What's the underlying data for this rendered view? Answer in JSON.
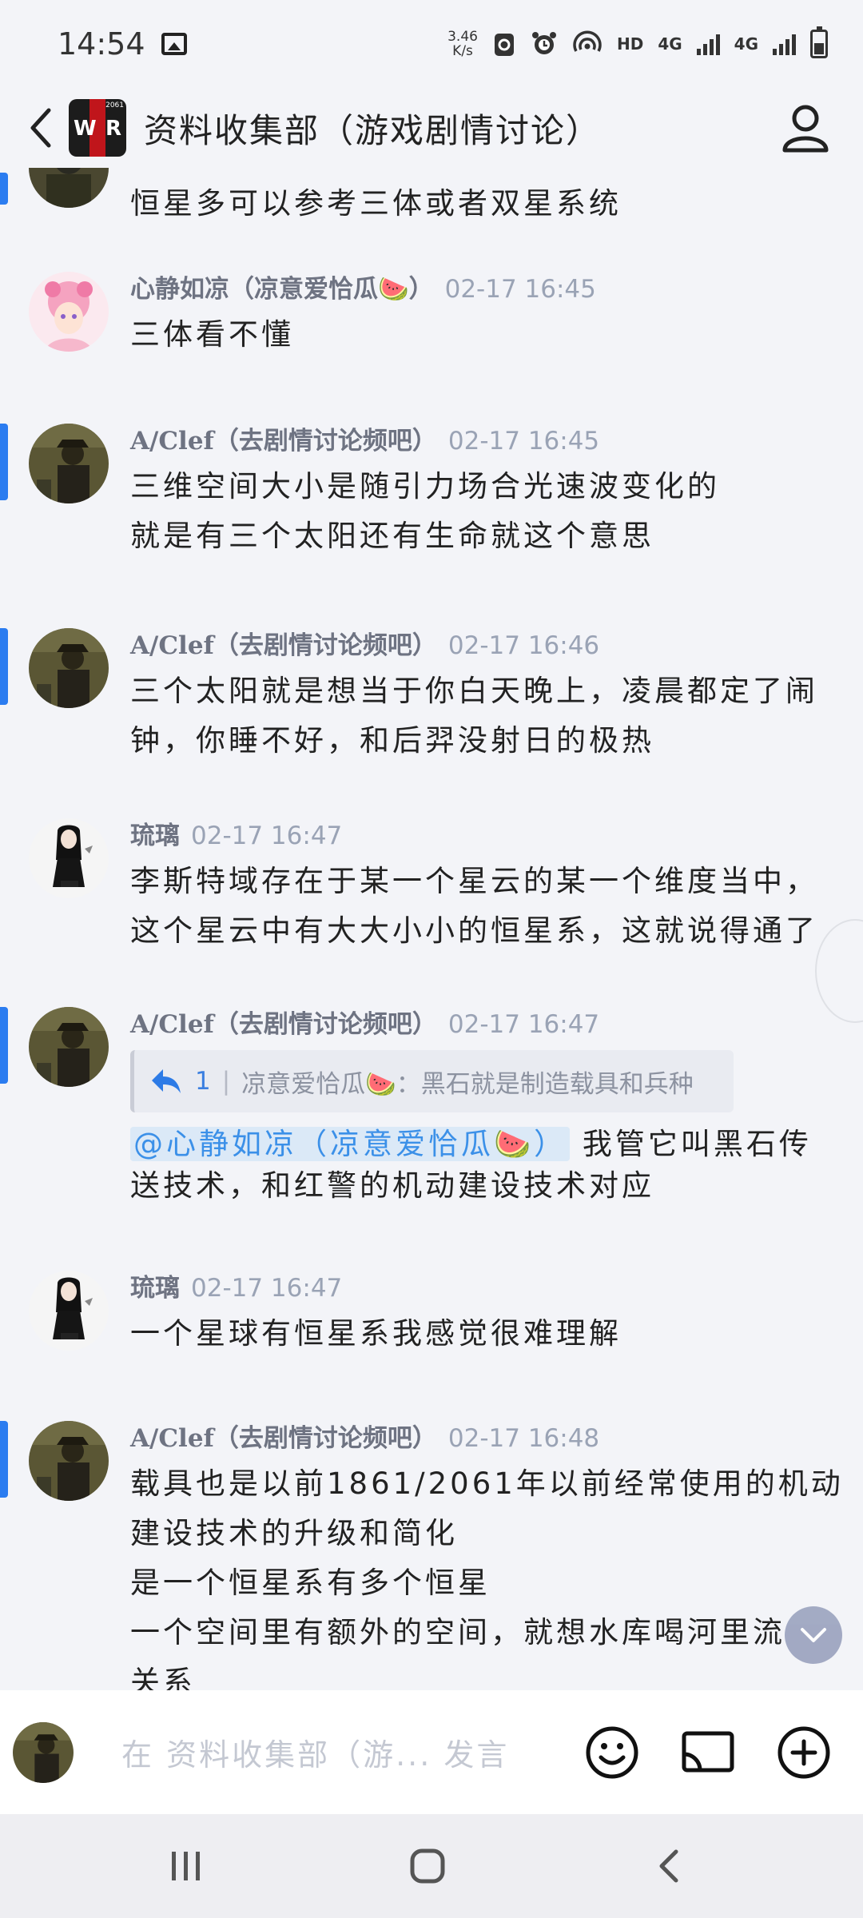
{
  "status_bar": {
    "time": "14:54",
    "net_speed_value": "3.46",
    "net_speed_unit": "K/s",
    "hd": "HD",
    "net1": "4G",
    "net2": "4G"
  },
  "header": {
    "title": "资料收集部（游戏剧情讨论）",
    "logo_year": "2061"
  },
  "messages": [
    {
      "id": "m0",
      "name": "",
      "time": "",
      "lines": [
        "恒星多可以参考三体或者双星系统"
      ]
    },
    {
      "id": "m1",
      "name": "心静如凉（凉意爱恰瓜🍉）",
      "time": "02-17 16:45",
      "lines": [
        "三体看不懂"
      ]
    },
    {
      "id": "m2",
      "name": "A/Clef（去剧情讨论频吧）",
      "time": "02-17 16:45",
      "lines": [
        "三维空间大小是随引力场合光速波变化的",
        "就是有三个太阳还有生命就这个意思"
      ]
    },
    {
      "id": "m3",
      "name": "A/Clef（去剧情讨论频吧）",
      "time": "02-17 16:46",
      "lines": [
        "三个太阳就是想当于你白天晚上，凌晨都定了闹",
        "钟，你睡不好，和后羿没射日的极热"
      ]
    },
    {
      "id": "m4",
      "name": "琉璃",
      "time": "02-17 16:47",
      "lines": [
        "李斯特域存在于某一个星云的某一个维度当中，",
        "这个星云中有大大小小的恒星系，这就说得通了"
      ]
    },
    {
      "id": "m5",
      "name": "A/Clef（去剧情讨论频吧）",
      "time": "02-17 16:47",
      "quote_count": "1",
      "quote_sep": "|",
      "quote_text": "凉意爱恰瓜🍉：黑石就是制造载具和兵种",
      "mention": "@心静如凉（凉意爱恰瓜🍉）",
      "mention_after": " 我管它叫黑石传",
      "line2": "送技术，和红警的机动建设技术对应"
    },
    {
      "id": "m6",
      "name": "琉璃",
      "time": "02-17 16:47",
      "lines": [
        "一个星球有恒星系我感觉很难理解"
      ]
    },
    {
      "id": "m7",
      "name": "A/Clef（去剧情讨论频吧）",
      "time": "02-17 16:48",
      "lines": [
        "载具也是以前1861/2061年以前经常使用的机动",
        "建设技术的升级和简化",
        "是一个恒星系有多个恒星",
        "一个空间里有额外的空间，就想水库喝河里流",
        "关系"
      ]
    }
  ],
  "input": {
    "placeholder": "在 资料收集部（游... 发言"
  },
  "colors": {
    "accent_blue": "#2b7cf0",
    "background": "#f3f4f8",
    "mention_blue": "#3b90e8"
  },
  "icons": [
    "back-icon",
    "profile-icon",
    "reply-icon",
    "chevron-down-icon",
    "emoji-icon",
    "cast-icon",
    "add-icon",
    "recents-icon",
    "home-icon",
    "nav-back-icon"
  ]
}
